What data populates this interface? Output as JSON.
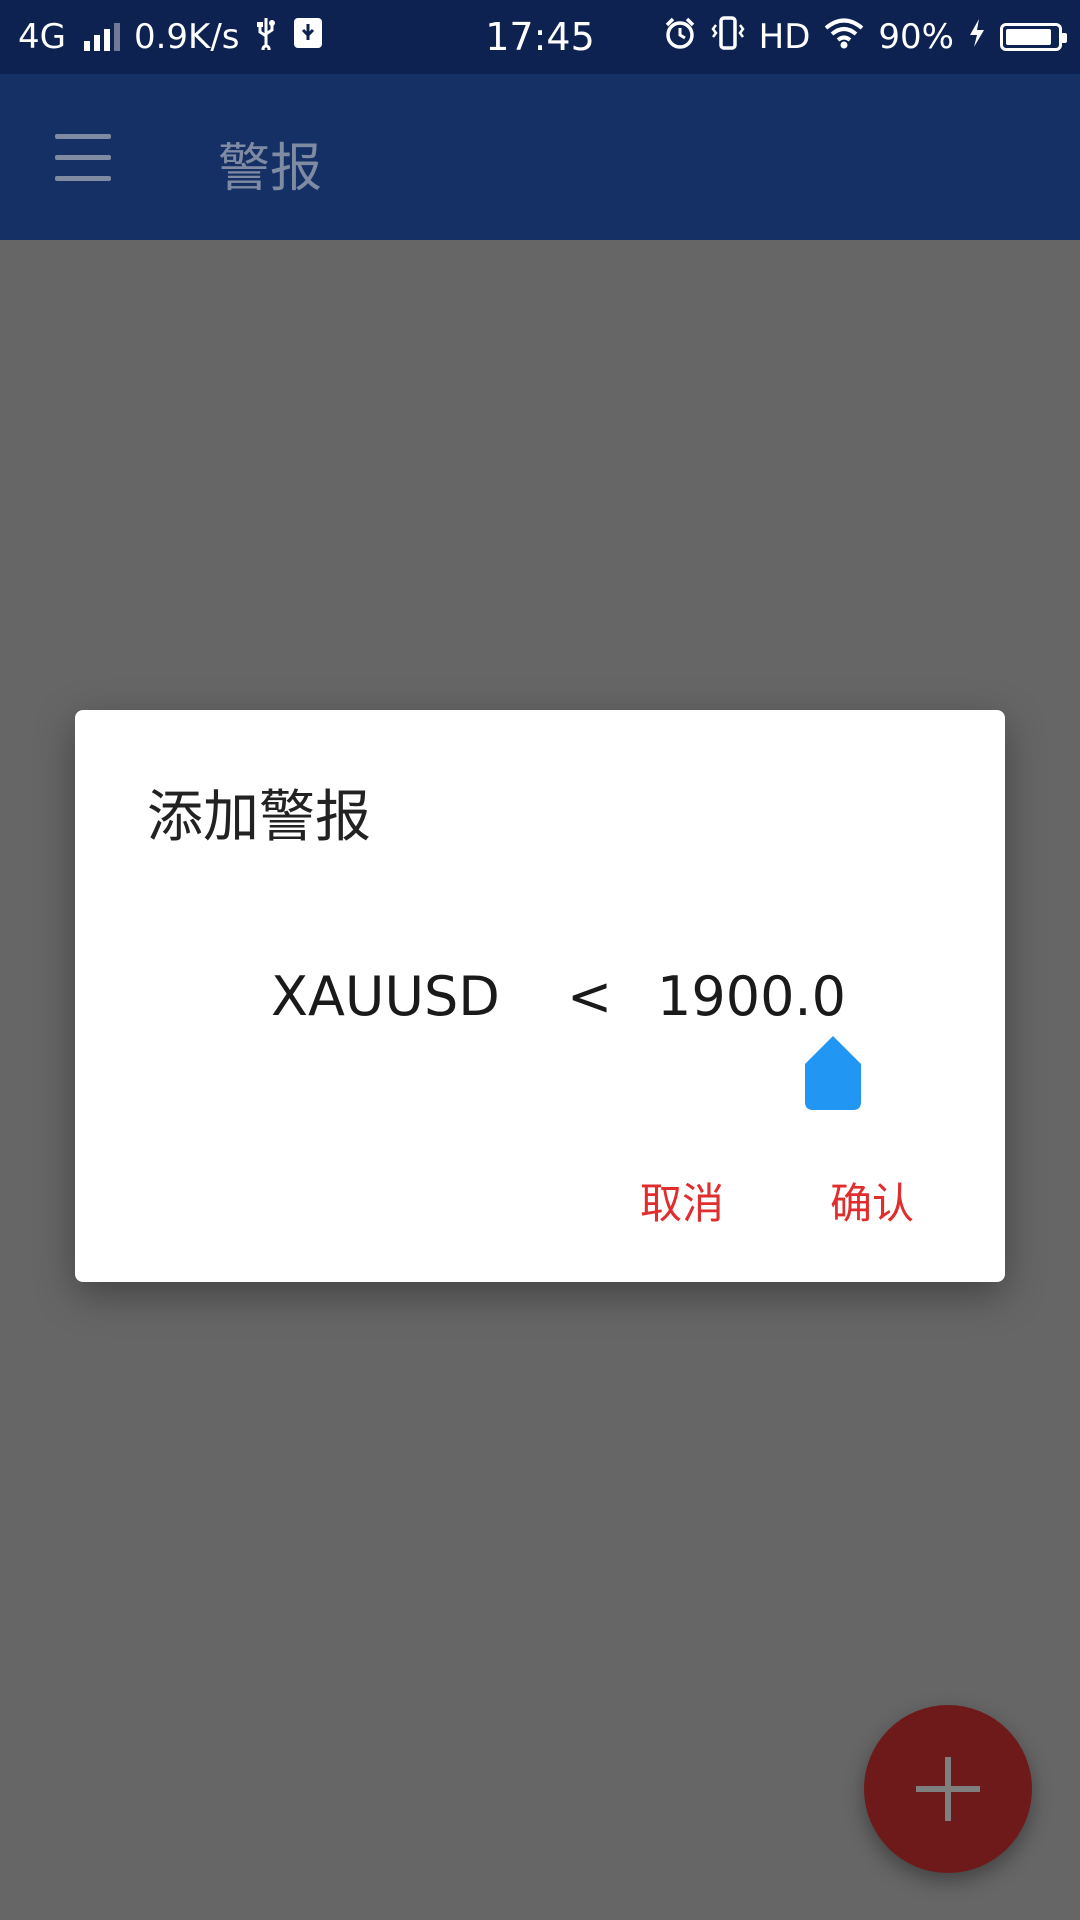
{
  "status_bar": {
    "network": "4G",
    "speed": "0.9K/s",
    "time": "17:45",
    "hd": "HD",
    "battery": "90%",
    "battery_level": 0.9,
    "icons": [
      "signal-icon",
      "usb-icon",
      "usb-debug-icon",
      "alarm-icon",
      "vibrate-icon",
      "wifi-icon",
      "charging-icon",
      "battery-icon"
    ]
  },
  "app_bar": {
    "title": "警报",
    "menu_icon": "hamburger-menu-icon"
  },
  "dialog": {
    "title": "添加警报",
    "symbol": "XAUUSD",
    "operator": "<",
    "value": "1900.0",
    "cancel_label": "取消",
    "confirm_label": "确认",
    "accent_color": "#e02d2d",
    "cursor_color": "#2196f3"
  },
  "fab": {
    "icon": "plus-icon",
    "color": "#6e1a1a"
  }
}
